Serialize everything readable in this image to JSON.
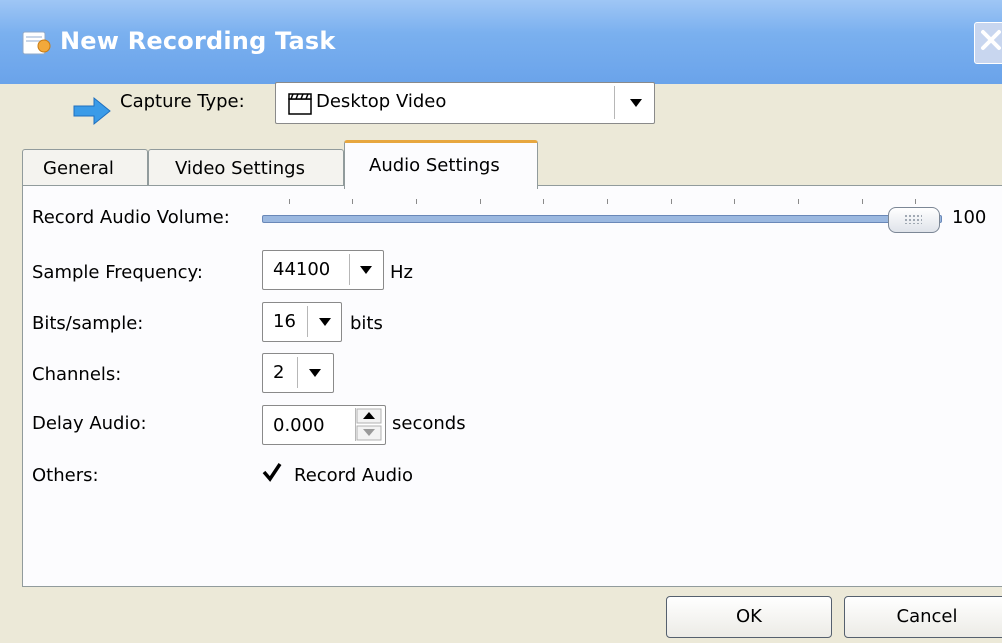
{
  "window": {
    "title": "New Recording Task"
  },
  "capture": {
    "label": "Capture Type:",
    "value": "Desktop Video"
  },
  "tabs": [
    {
      "label": "General",
      "active": false
    },
    {
      "label": "Video Settings",
      "active": false
    },
    {
      "label": "Audio Settings",
      "active": true
    }
  ],
  "audio": {
    "volume": {
      "label": "Record Audio Volume:",
      "value": "100",
      "level_percent": 100
    },
    "sample_frequency": {
      "label": "Sample Frequency:",
      "value": "44100",
      "unit": "Hz"
    },
    "bits_per_sample": {
      "label": "Bits/sample:",
      "value": "16",
      "unit": "bits"
    },
    "channels": {
      "label": "Channels:",
      "value": "2"
    },
    "delay": {
      "label": "Delay Audio:",
      "value": "0.000",
      "unit": "seconds"
    },
    "others": {
      "label": "Others:",
      "record_audio_label": "Record Audio",
      "record_audio_checked": true
    }
  },
  "buttons": {
    "ok": "OK",
    "cancel": "Cancel"
  },
  "colors": {
    "titlebar": "#7ab0ef",
    "active_tab_accent": "#e7a73f",
    "slider": "#9bb8e0"
  },
  "icons": {
    "title": "recording-task-icon",
    "capture": "arrow-right-icon",
    "capture_value": "clapperboard-icon"
  }
}
